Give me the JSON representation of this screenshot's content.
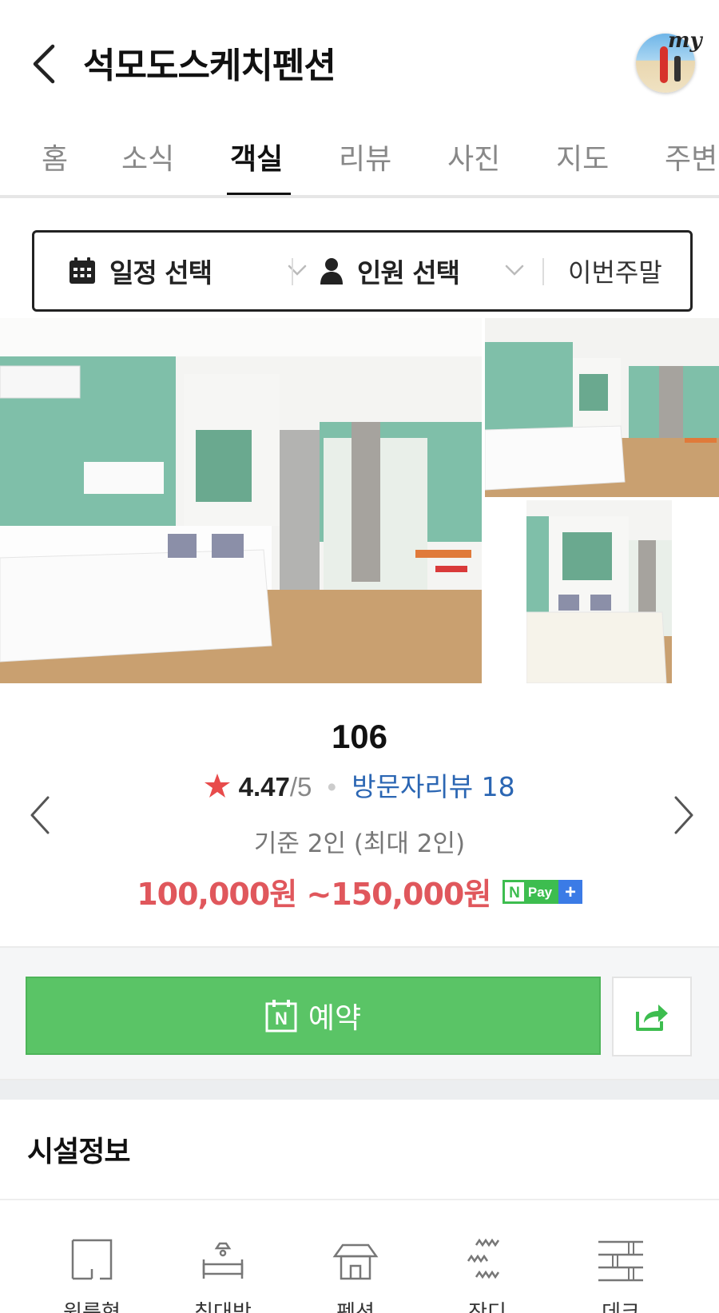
{
  "header": {
    "title": "석모도스케치펜션",
    "my_label": "my"
  },
  "tabs": [
    {
      "label": "홈",
      "active": false
    },
    {
      "label": "소식",
      "active": false
    },
    {
      "label": "객실",
      "active": true
    },
    {
      "label": "리뷰",
      "active": false
    },
    {
      "label": "사진",
      "active": false
    },
    {
      "label": "지도",
      "active": false
    },
    {
      "label": "주변",
      "active": false
    }
  ],
  "filters": {
    "date_label": "일정 선택",
    "people_label": "인원 선택",
    "weekend_label": "이번주말"
  },
  "room": {
    "name": "106",
    "rating": "4.47",
    "rating_max": "/5",
    "review_label": "방문자리뷰 18",
    "capacity": "기준 2인 (최대 2인)",
    "price": "100,000원 ~150,000원",
    "npay_n": "N",
    "npay_pay": "Pay",
    "npay_plus": "+"
  },
  "booking": {
    "book_label": "예약",
    "book_icon_letter": "N"
  },
  "facilities": {
    "title": "시설정보",
    "items": [
      {
        "icon": "one-room-icon",
        "label": "원룸형"
      },
      {
        "icon": "bed-icon",
        "label": "침대방"
      },
      {
        "icon": "pension-icon",
        "label": "펜션"
      },
      {
        "icon": "lawn-icon",
        "label": "잔디"
      },
      {
        "icon": "deck-icon",
        "label": "데크"
      }
    ]
  },
  "colors": {
    "accent_green": "#5ac466",
    "price_red": "#e0575c",
    "review_blue": "#2b66b3",
    "star_red": "#e84b4b"
  }
}
